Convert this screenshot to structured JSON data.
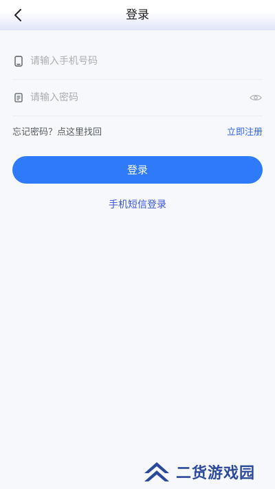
{
  "header": {
    "title": "登录"
  },
  "form": {
    "phone_placeholder": "请输入手机号码",
    "password_placeholder": "请输入密码",
    "forgot_password": "忘记密码？点这里找回",
    "register": "立即注册",
    "login_button": "登录",
    "sms_login": "手机短信登录"
  },
  "icons": {
    "back": "chevron-left-icon",
    "phone": "phone-icon",
    "password": "lock-icon",
    "visibility": "eye-icon"
  },
  "watermark": {
    "text": "二货游戏园"
  },
  "colors": {
    "primary_button": "#2f7af8",
    "link_blue": "#2f64e8",
    "sms_link": "#3a55d9",
    "background": "#f7f8fc"
  }
}
